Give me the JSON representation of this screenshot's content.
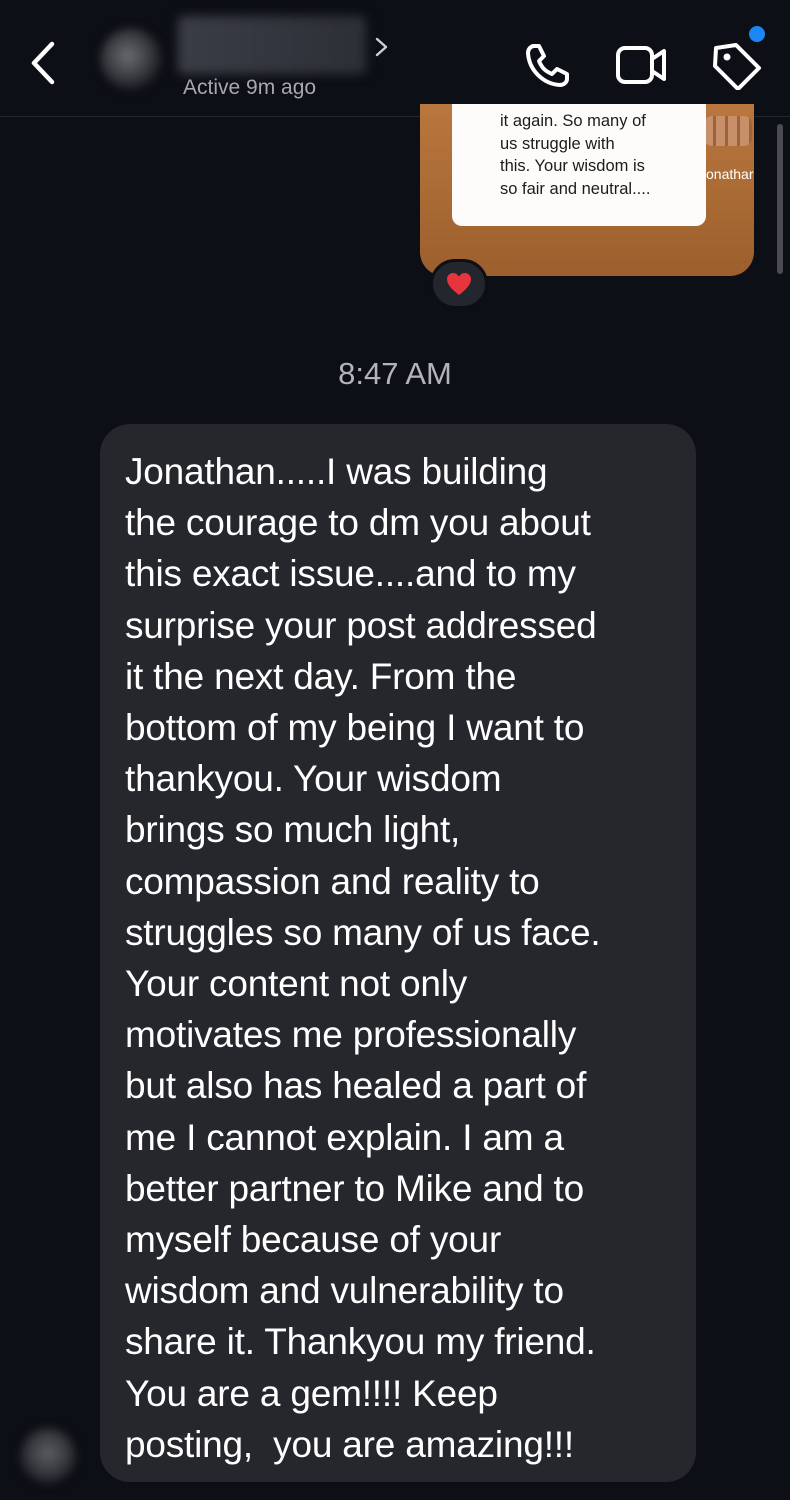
{
  "header": {
    "active_status": "Active 9m ago"
  },
  "shared_post": {
    "caption": "it again. So many of\nus struggle with\nthis. Your wisdom is\nso fair and neutral....",
    "handle_fragment": "onathar",
    "reaction": "❤️"
  },
  "thread": {
    "timestamp": "8:47 AM",
    "message": {
      "text": "Jonathan.....I was building\nthe courage to dm you about\nthis exact issue....and to my\nsurprise your post addressed\nit the next day. From the\nbottom of my being I want to\nthankyou. Your wisdom\nbrings so much light,\ncompassion and reality to\nstruggles so many of us face.\nYour content not only\nmotivates me professionally\nbut also has healed a part of\nme I cannot explain. I am a\nbetter partner to Mike and to\nmyself because of your\nwisdom and vulnerability to\nshare it. Thankyou my friend.\nYou are a gem!!!! Keep\nposting,  you are amazing!!!"
    }
  },
  "colors": {
    "background": "#0d0f16",
    "bubble": "#26272d",
    "accent_dot": "#1b86f5",
    "reaction_heart": "#e8343d"
  },
  "icons": [
    "back-icon",
    "chevron-right-icon",
    "phone-icon",
    "video-icon",
    "tag-icon",
    "heart-icon"
  ]
}
